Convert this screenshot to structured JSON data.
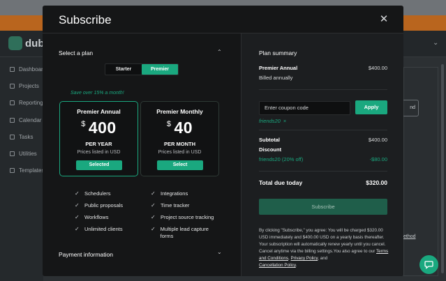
{
  "background": {
    "logo_text": "dub",
    "nav": [
      "Dashboard",
      "Projects",
      "Reporting",
      "Calendar",
      "Tasks",
      "Utilities",
      "Templates"
    ],
    "button_fragment": "nd",
    "link_fragment": "ethod"
  },
  "modal": {
    "title": "Subscribe",
    "close_icon": "close-icon"
  },
  "plan": {
    "section_title": "Select a plan",
    "toggle": [
      "Starter",
      "Premier"
    ],
    "save_note": "Save over 15% a month!",
    "cards": [
      {
        "name": "Premier Annual",
        "currency": "$",
        "amount": "400",
        "period": "PER YEAR",
        "listed": "Prices listed in USD",
        "button": "Selected"
      },
      {
        "name": "Premier Monthly",
        "currency": "$",
        "amount": "40",
        "period": "PER MONTH",
        "listed": "Prices listed in USD",
        "button": "Select"
      }
    ],
    "features_left": [
      "Schedulers",
      "Public proposals",
      "Workflows",
      "Unlimited clients"
    ],
    "features_right": [
      "Integrations",
      "Time tracker",
      "Project source tracking",
      "Multiple lead capture forms"
    ],
    "payment_title": "Payment information"
  },
  "summary": {
    "title": "Plan summary",
    "plan_name": "Premier Annual",
    "plan_price": "$400.00",
    "billing": "Billed annually",
    "coupon_placeholder": "Enter coupon code",
    "apply": "Apply",
    "applied_code": "friends20",
    "remove": "×",
    "subtotal_label": "Subtotal",
    "subtotal_value": "$400.00",
    "discount_label": "Discount",
    "discount_code": "friends20 (20% off)",
    "discount_value": "-$80.00",
    "total_label": "Total due today",
    "total_value": "$320.00",
    "subscribe": "Subscribe",
    "fine_1": "By clicking \"Subscribe,\" you agree: You will be charged $320.00 USD immediately and $400.00 USD on a yearly basis thereafter. Your subscription will automatically renew yearly until you cancel. Cancel anytime via the billing settings.You also agree to our ",
    "terms": "Terms and Conditions",
    "sep_1": ", ",
    "privacy": "Privacy Policy",
    "sep_2": ", and ",
    "cancellation": "Cancellation Policy",
    "end": "."
  },
  "colors": {
    "accent": "#1aa87f",
    "modal_bg": "#151617",
    "summary_bg": "#1c1e20"
  }
}
